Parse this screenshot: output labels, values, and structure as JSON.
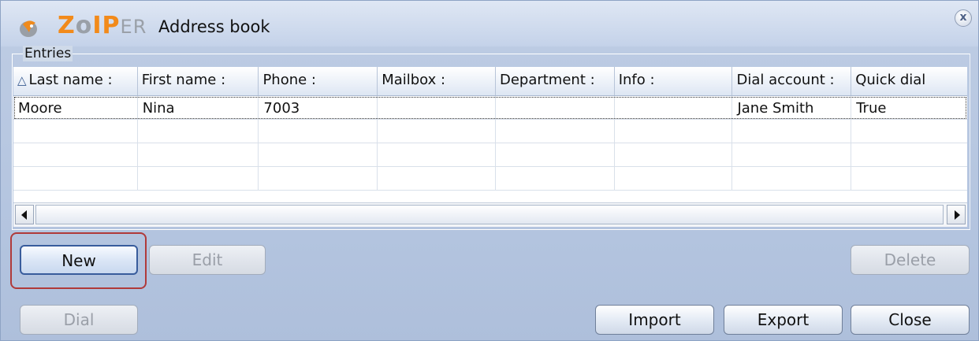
{
  "window": {
    "brand": {
      "z": "Z",
      "o": "o",
      "ip": "IP",
      "er": "ER"
    },
    "title": "Address book",
    "close_glyph": "x",
    "logo_icon": "zoiper-bird-icon"
  },
  "entries": {
    "group_label": "Entries",
    "sort_glyph": "△",
    "columns": [
      "Last name :",
      "First name :",
      "Phone :",
      "Mailbox :",
      "Department :",
      "Info :",
      "Dial account :",
      "Quick dial"
    ],
    "rows": [
      [
        "Moore",
        "Nina",
        "7003",
        "",
        "",
        "",
        "Jane Smith",
        "True"
      ]
    ]
  },
  "buttons": {
    "new": "New",
    "edit": "Edit",
    "delete": "Delete",
    "dial": "Dial",
    "import": "Import",
    "export": "Export",
    "close": "Close"
  },
  "colors": {
    "brand_orange": "#f28a1a",
    "highlight": "#b03a3a"
  }
}
